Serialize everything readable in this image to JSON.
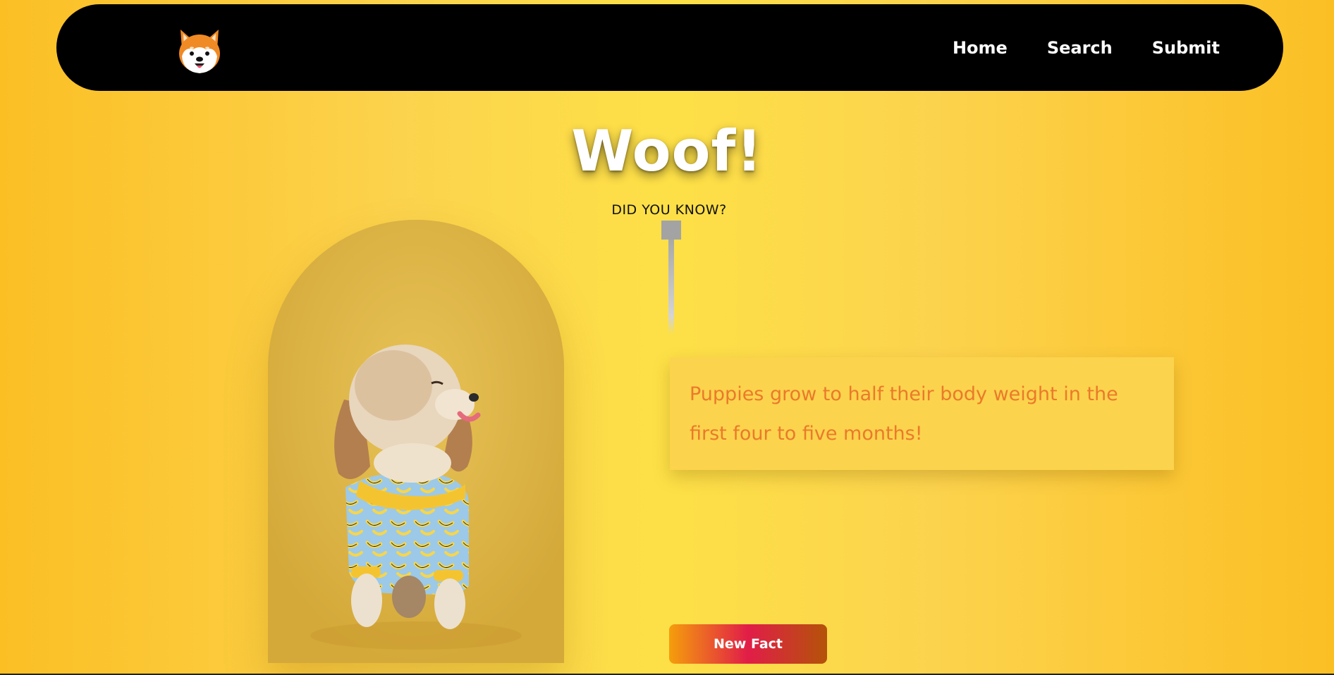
{
  "nav": {
    "logo_icon": "shiba-dog-logo-icon",
    "links": [
      "Home",
      "Search",
      "Submit"
    ]
  },
  "hero": {
    "title": "Woof!",
    "subtitle": "DID YOU KNOW?"
  },
  "fact": {
    "text": "Puppies grow to half their body weight in the first four to five months!"
  },
  "button": {
    "label": "New Fact"
  },
  "image": {
    "subject": "dog-photo"
  },
  "colors": {
    "background": "#fcd34d",
    "navbar": "#000000",
    "fact_text": "#ea7a2a",
    "button_gradient_start": "#f59e0b",
    "button_gradient_mid": "#e11d48",
    "button_gradient_end": "#b45309"
  }
}
